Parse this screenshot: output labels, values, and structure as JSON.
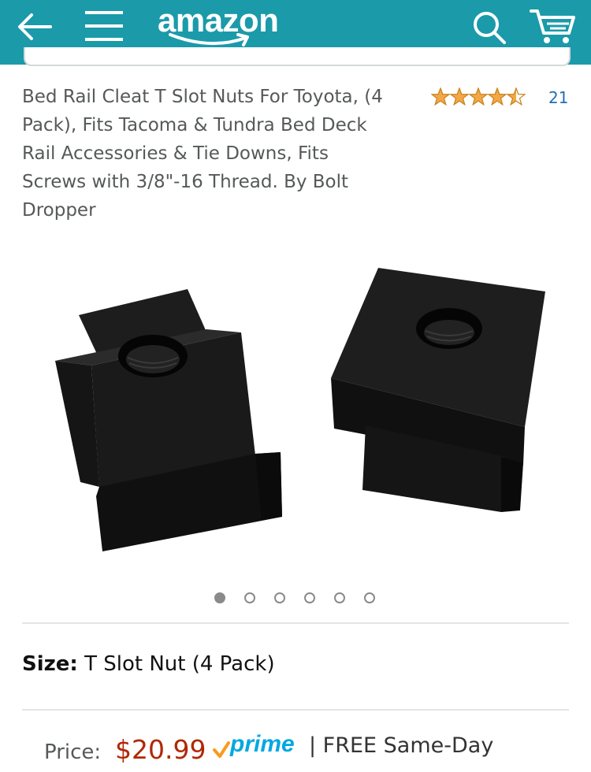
{
  "header": {
    "brand": "amazon",
    "back_icon": "arrow-left-icon",
    "menu_icon": "hamburger-menu-icon",
    "search_icon": "search-icon",
    "cart_icon": "cart-icon",
    "background_color": "#1b9aaa"
  },
  "product": {
    "title": "Bed Rail Cleat T Slot Nuts For Toyota, (4 Pack), Fits Tacoma & Tundra Bed Deck Rail Accessories & Tie Downs, Fits Screws with 3/8\"-16 Thread. By Bolt Dropper",
    "rating": 4.5,
    "rating_count": "21",
    "image_description": "two black T slot nuts",
    "carousel": {
      "total": 6,
      "active_index": 0
    },
    "size_label": "Size:",
    "size_value": "T Slot Nut (4 Pack)",
    "price_label": "Price:",
    "price_value": "$20.99",
    "prime_label": "prime",
    "shipping": "| FREE Same-Day"
  },
  "colors": {
    "price": "#b12704",
    "link": "#1f6fb2",
    "star": "#f3a847",
    "prime": "#00a8e1"
  }
}
